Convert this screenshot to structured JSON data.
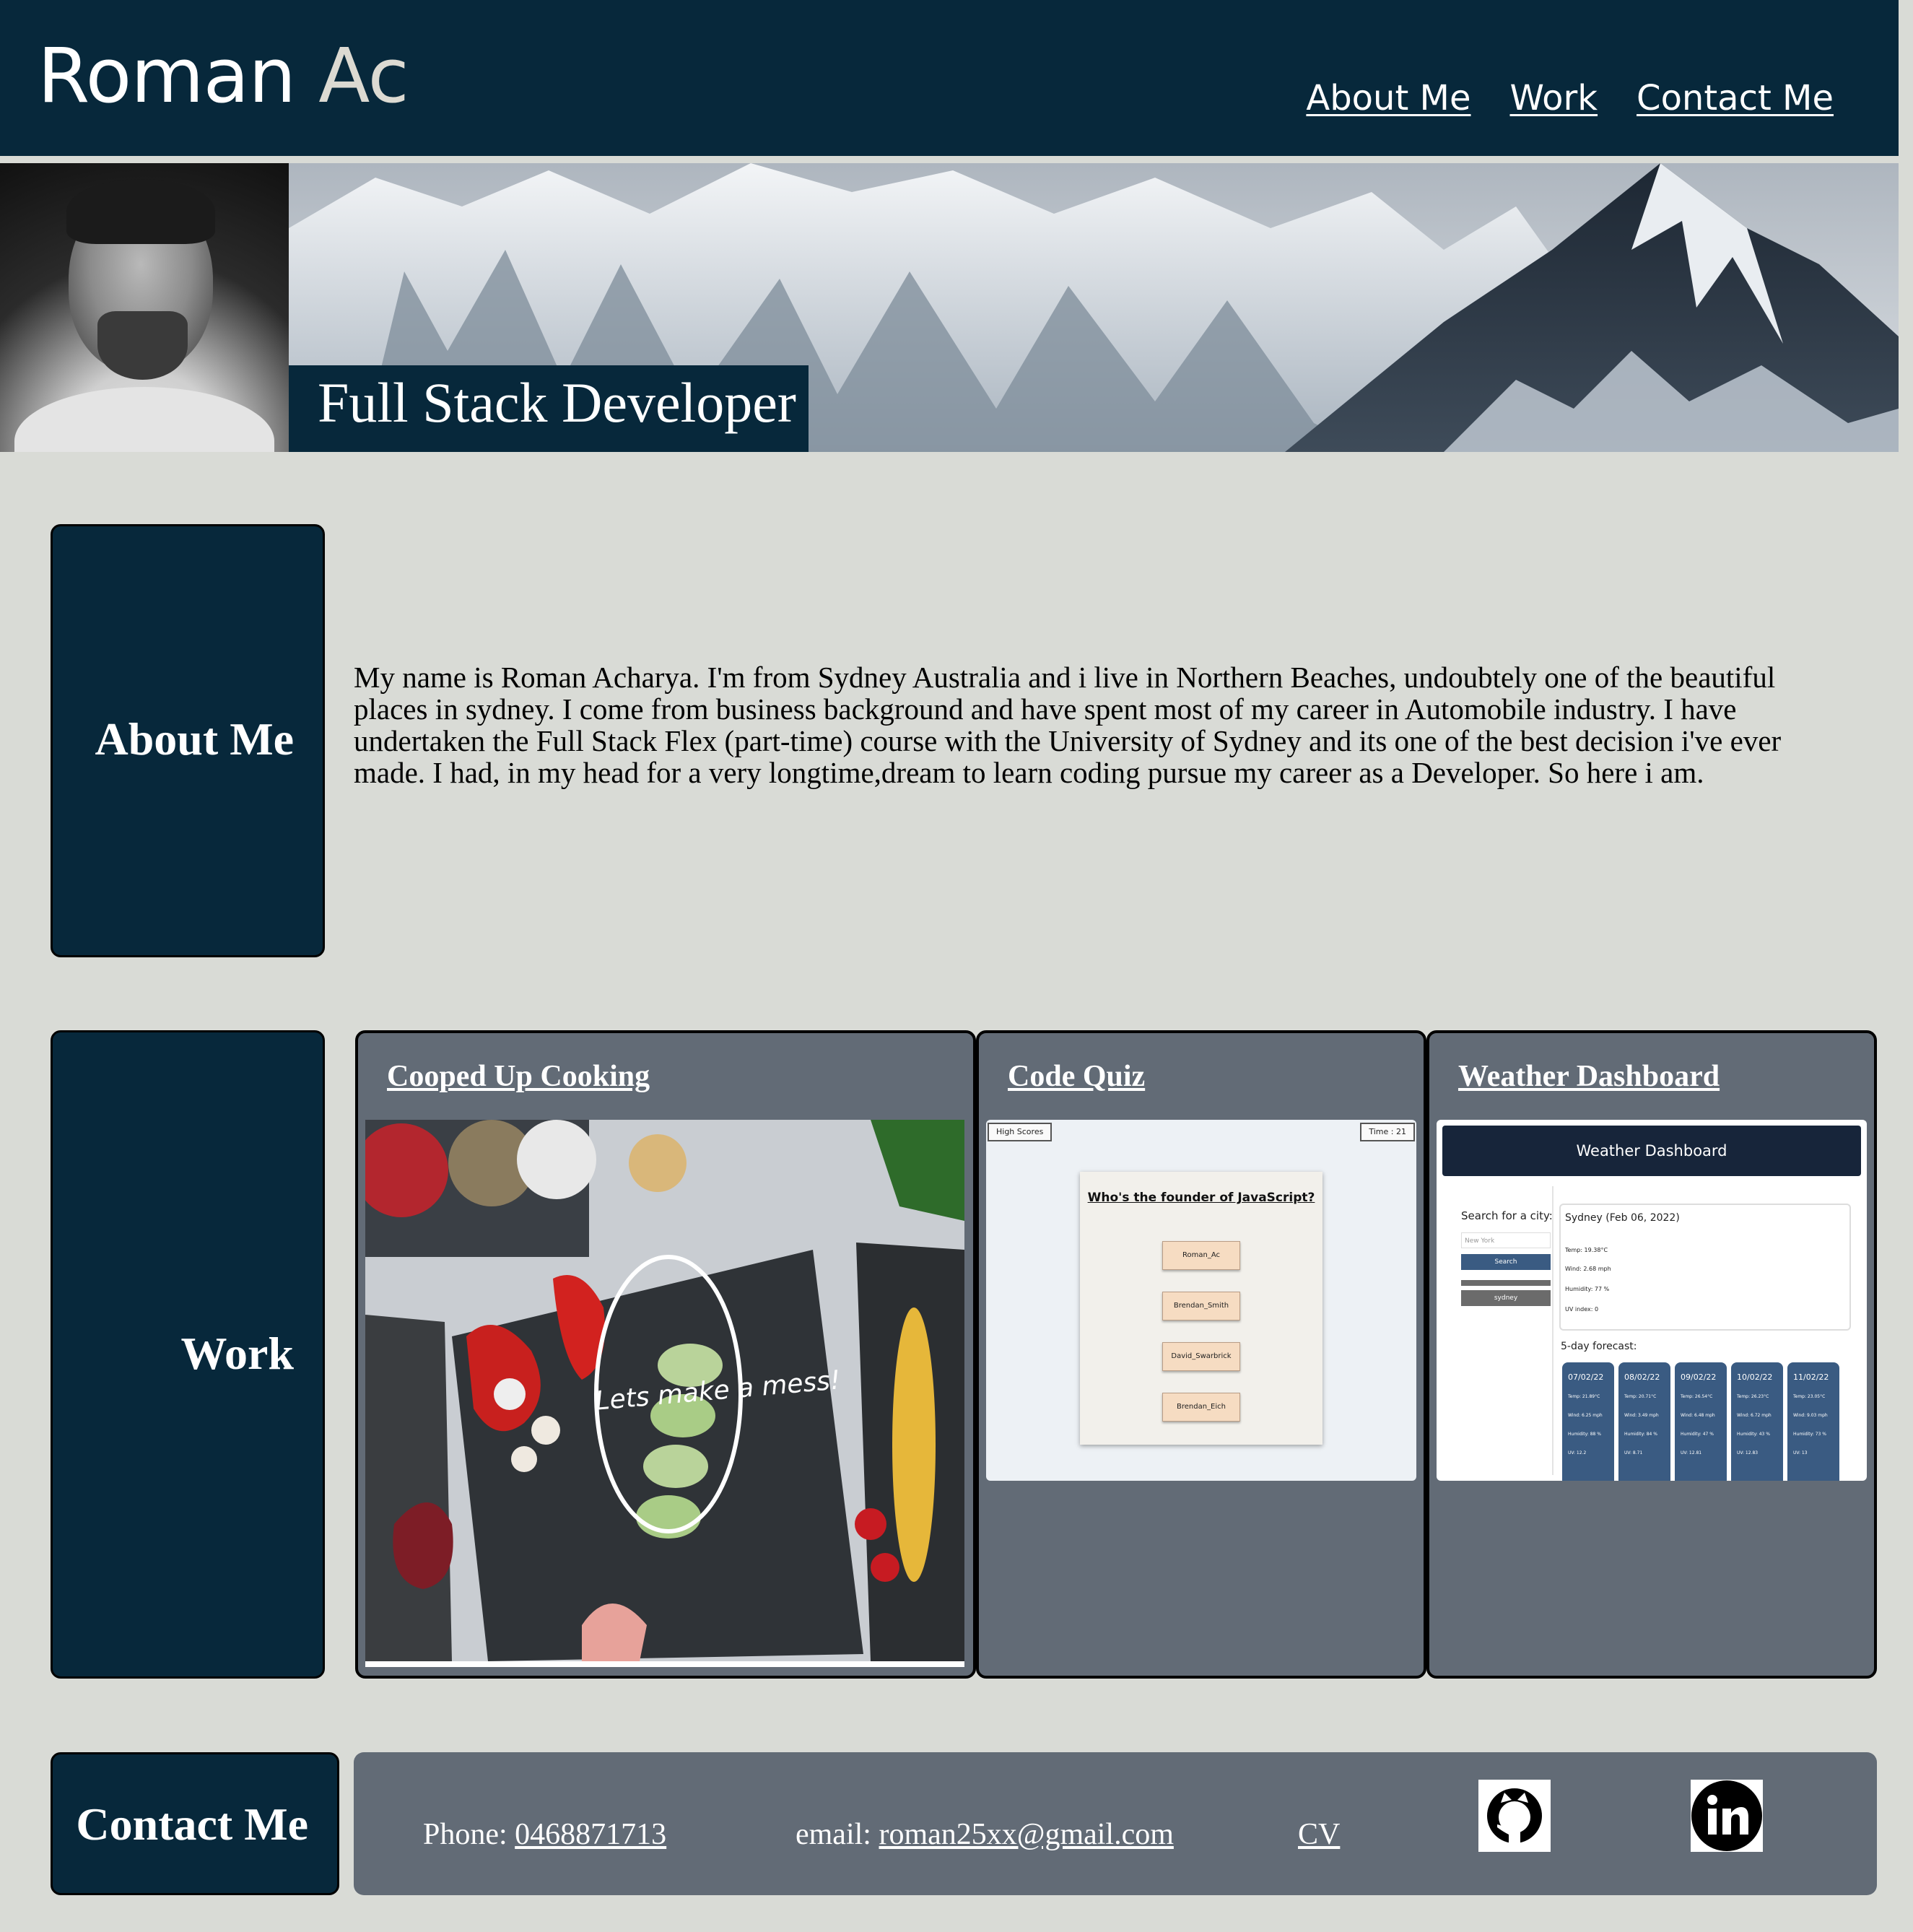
{
  "header": {
    "brand_first": "Roman",
    "brand_second": " Ac",
    "nav": [
      "About Me",
      "Work",
      "Contact Me"
    ]
  },
  "hero": {
    "tagline": "Full Stack Developer"
  },
  "about": {
    "heading": "About Me",
    "text": "My name is Roman Acharya. I'm from Sydney Australia and i live in Northern Beaches, undoubtely one of the beautiful places in sydney. I come from business background and have spent most of my career in Automobile industry. I have undertaken the Full Stack Flex (part-time) course with the University of Sydney and its one of the best decision i've ever made. I had, in my head for a very longtime,dream to learn coding pursue my career as a Developer. So here i am."
  },
  "work": {
    "heading": "Work",
    "projects": [
      {
        "title": "Cooped Up Cooking",
        "screenshot_text": "Lets make a mess!"
      },
      {
        "title": "Code Quiz",
        "screenshot": {
          "high_scores": "High Scores",
          "timer": "Time : 21",
          "question": "Who's the founder of JavaScript?",
          "answers": [
            "Roman_Ac",
            "Brendan_Smith",
            "David_Swarbrick",
            "Brendan_Eich"
          ]
        }
      },
      {
        "title": "Weather Dashboard",
        "screenshot": {
          "title": "Weather Dashboard",
          "search_label": "Search for a city:",
          "search_placeholder": "New York",
          "search_button": "Search",
          "history": "sydney",
          "city_date": "Sydney (Feb 06, 2022)",
          "temp": "Temp: 19.38°C",
          "wind": "Wind: 2.68 mph",
          "humidity": "Humidity: 77 %",
          "uv": "UV index: 0",
          "forecast_label": "5-day forecast:",
          "forecast": [
            {
              "date": "07/02/22",
              "temp": "Temp: 21.89°C",
              "wind": "Wind: 6.25 mph",
              "humidity": "Humidity: 88 %",
              "uv": "UV: 12.2"
            },
            {
              "date": "08/02/22",
              "temp": "Temp: 20.71°C",
              "wind": "Wind: 3.49 mph",
              "humidity": "Humidity: 84 %",
              "uv": "UV: 8.71"
            },
            {
              "date": "09/02/22",
              "temp": "Temp: 26.54°C",
              "wind": "Wind: 6.48 mph",
              "humidity": "Humidity: 47 %",
              "uv": "UV: 12.81"
            },
            {
              "date": "10/02/22",
              "temp": "Temp: 26.23°C",
              "wind": "Wind: 6.72 mph",
              "humidity": "Humidity: 43 %",
              "uv": "UV: 12.83"
            },
            {
              "date": "11/02/22",
              "temp": "Temp: 23.05°C",
              "wind": "Wind: 9.03 mph",
              "humidity": "Humidity: 73 %",
              "uv": "UV: 13"
            }
          ]
        }
      }
    ]
  },
  "contact": {
    "heading": "Contact Me",
    "phone_label": "Phone: ",
    "phone": "0468871713",
    "email_label": "email: ",
    "email": "roman25xx@gmail.com",
    "cv": "CV",
    "icons": [
      "github-icon",
      "linkedin-icon"
    ]
  },
  "colors": {
    "header_bg": "#07283b",
    "page_bg": "#d9dbd6",
    "card_bg": "#626b76",
    "weather_card": "#3a5b82"
  }
}
